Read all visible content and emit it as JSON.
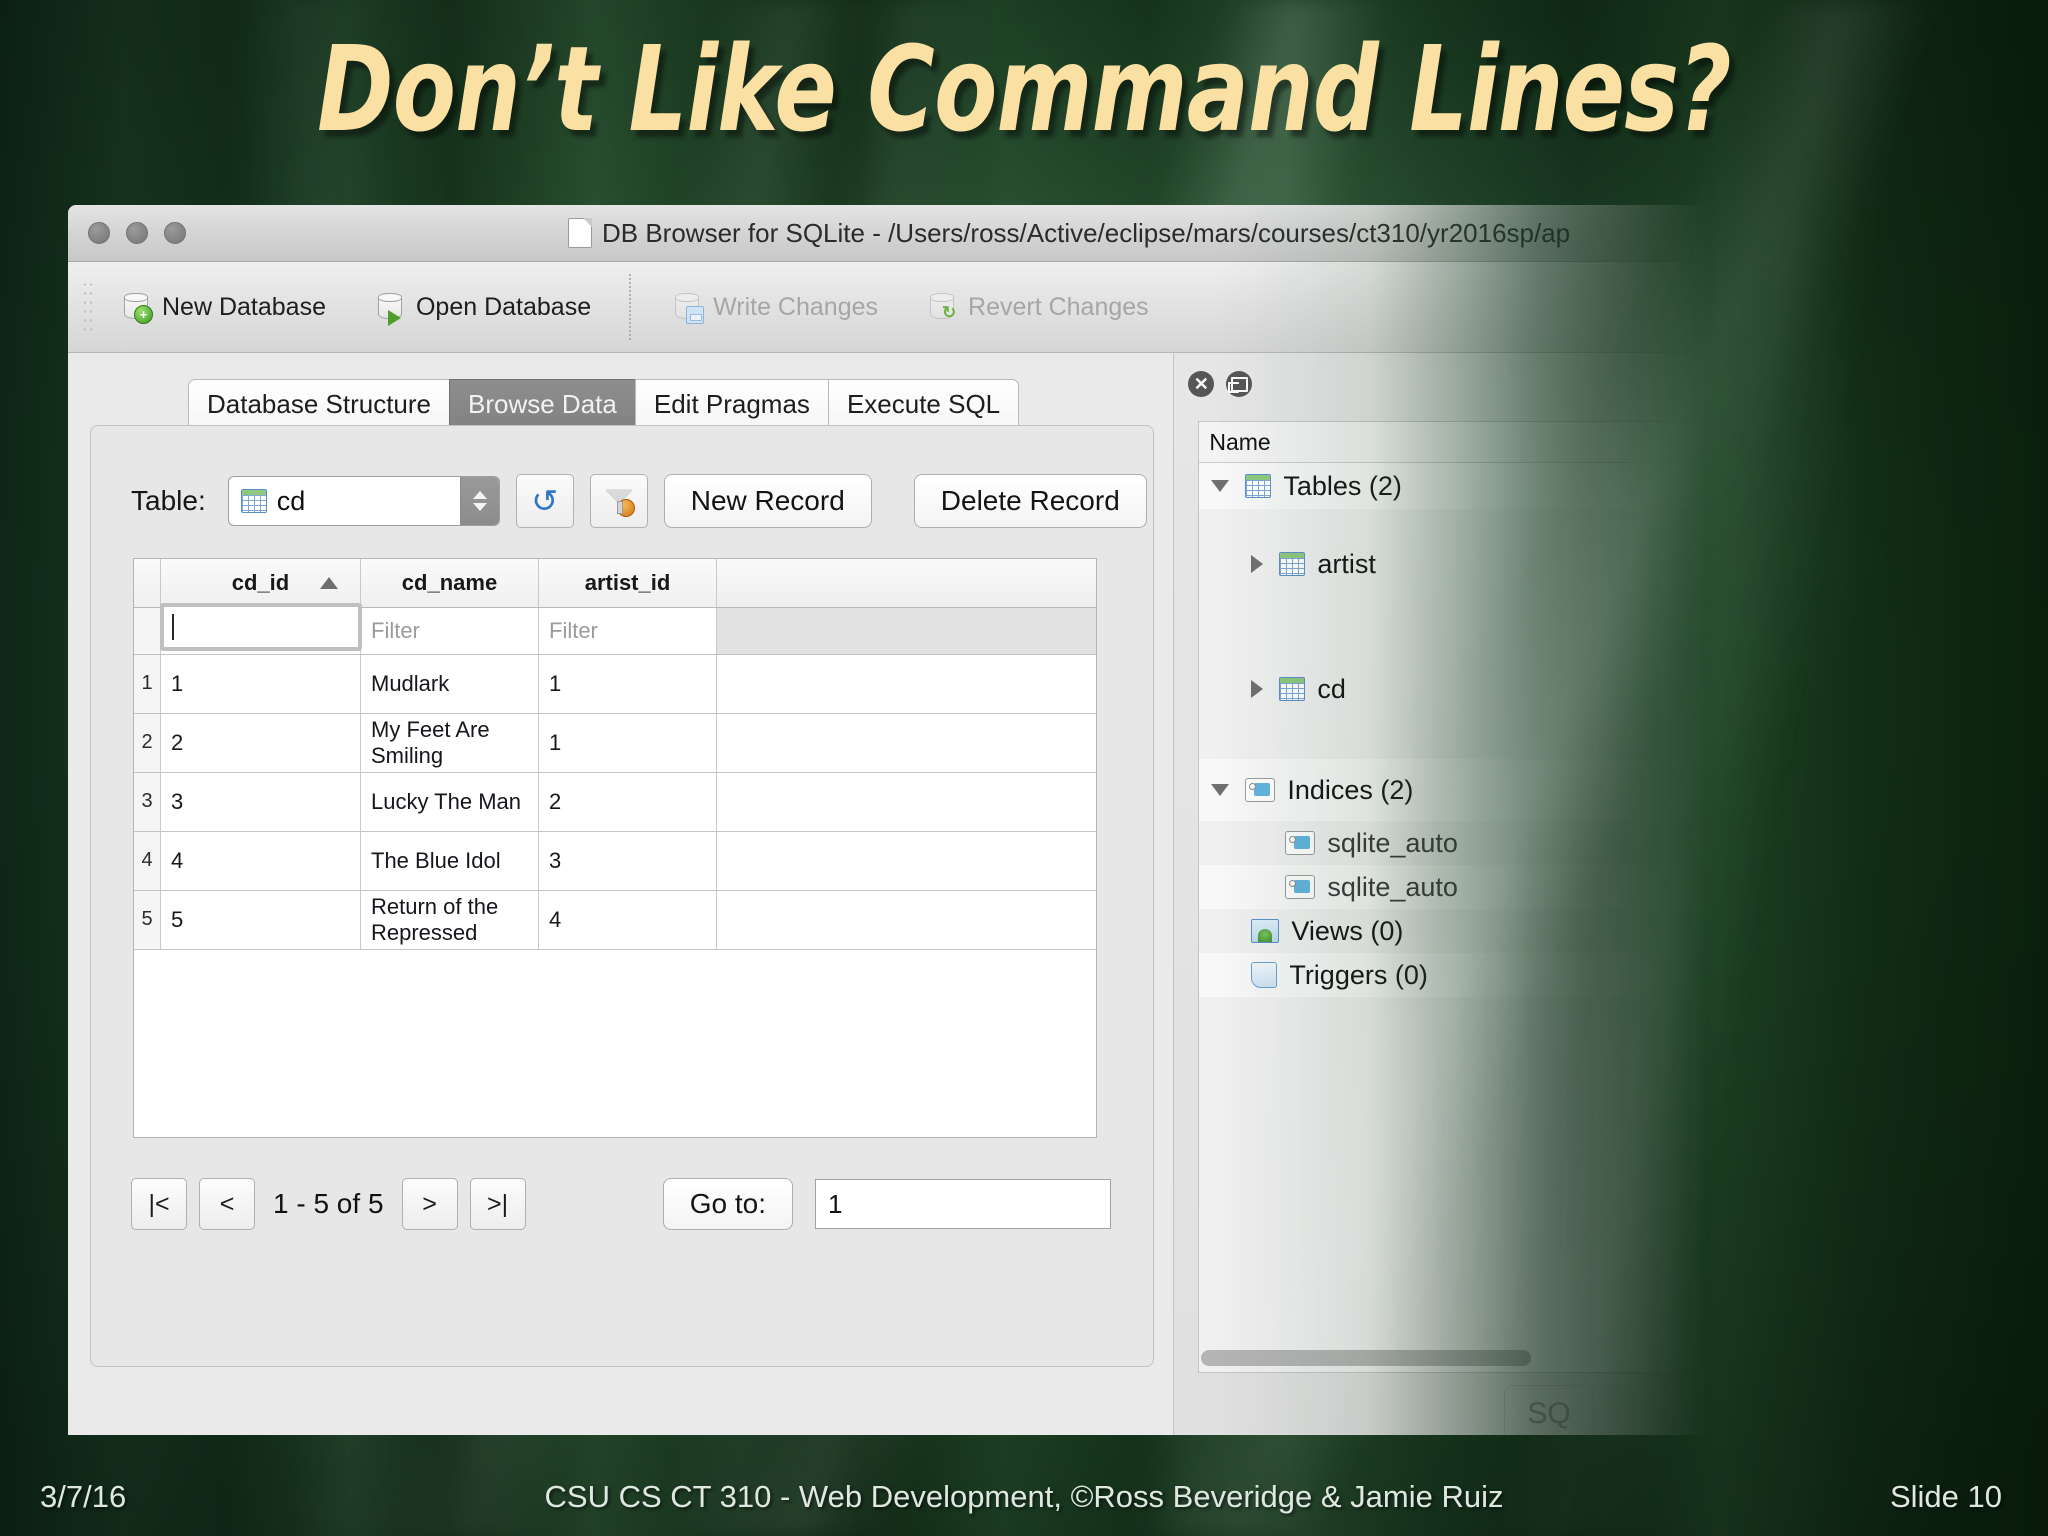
{
  "slide": {
    "title": "Don’t Like Command Lines?",
    "footer": {
      "date": "3/7/16",
      "center": "CSU CS CT 310 - Web Development, ©Ross Beveridge & Jamie Ruiz",
      "slide_number": "Slide 10"
    },
    "colors": {
      "title_text": "#fbe0a4",
      "background_green": "#1c4026",
      "footer_text": "#dfe8e0"
    }
  },
  "app": {
    "window_title": "DB Browser for SQLite - /Users/ross/Active/eclipse/mars/courses/ct310/yr2016sp/ap",
    "traffic_lights": [
      "close",
      "minimize",
      "zoom"
    ],
    "toolbar": [
      {
        "label": "New Database",
        "icon": "database-plus-icon",
        "enabled": true
      },
      {
        "label": "Open Database",
        "icon": "database-open-icon",
        "enabled": true
      },
      {
        "label": "Write Changes",
        "icon": "database-save-icon",
        "enabled": false
      },
      {
        "label": "Revert Changes",
        "icon": "database-revert-icon",
        "enabled": false
      }
    ],
    "tabs": [
      {
        "label": "Database Structure",
        "active": false
      },
      {
        "label": "Browse Data",
        "active": true
      },
      {
        "label": "Edit Pragmas",
        "active": false
      },
      {
        "label": "Execute SQL",
        "active": false
      }
    ],
    "browse": {
      "table_label": "Table:",
      "table_value": "cd",
      "refresh_icon": "refresh-icon",
      "filter_icon": "clear-filters-icon",
      "new_record_label": "New Record",
      "delete_record_label": "Delete Record",
      "grid": {
        "columns": [
          "cd_id",
          "cd_name",
          "artist_id"
        ],
        "sorted_column": "cd_id",
        "sort_direction": "ascending",
        "filter_placeholder": "Filter",
        "filter_values": [
          "",
          "",
          ""
        ],
        "rows": [
          {
            "n": "1",
            "cd_id": "1",
            "cd_name": "Mudlark",
            "artist_id": "1"
          },
          {
            "n": "2",
            "cd_id": "2",
            "cd_name": "My Feet Are\nSmiling",
            "artist_id": "1"
          },
          {
            "n": "3",
            "cd_id": "3",
            "cd_name": "Lucky The Man",
            "artist_id": "2"
          },
          {
            "n": "4",
            "cd_id": "4",
            "cd_name": "The Blue Idol",
            "artist_id": "3"
          },
          {
            "n": "5",
            "cd_id": "5",
            "cd_name": "Return of the\nRepressed",
            "artist_id": "4"
          }
        ]
      },
      "pager": {
        "first_label": "|<",
        "prev_label": "<",
        "count_label": "1 - 5 of 5",
        "next_label": ">",
        "last_label": ">|",
        "goto_label": "Go to:",
        "goto_value": "1"
      }
    },
    "dock": {
      "close_icon": "close-icon",
      "float_icon": "undock-icon",
      "column_header": "Name",
      "tree": [
        {
          "label": "Tables (2)",
          "icon": "table-icon",
          "twisty": "open",
          "depth": 0
        },
        {
          "label": "artist",
          "icon": "table-icon",
          "twisty": "closed",
          "depth": 1
        },
        {
          "label": "cd",
          "icon": "table-icon",
          "twisty": "closed",
          "depth": 1
        },
        {
          "label": "Indices (2)",
          "icon": "index-tag-icon",
          "twisty": "open",
          "depth": 0
        },
        {
          "label": "sqlite_auto",
          "icon": "index-tag-icon",
          "twisty": "none",
          "depth": 1
        },
        {
          "label": "sqlite_auto",
          "icon": "index-tag-icon",
          "twisty": "none",
          "depth": 1
        },
        {
          "label": "Views (0)",
          "icon": "view-icon",
          "twisty": "none",
          "depth": 0
        },
        {
          "label": "Triggers (0)",
          "icon": "trigger-icon",
          "twisty": "none",
          "depth": 0
        }
      ],
      "ghost_button": "SQ"
    }
  }
}
